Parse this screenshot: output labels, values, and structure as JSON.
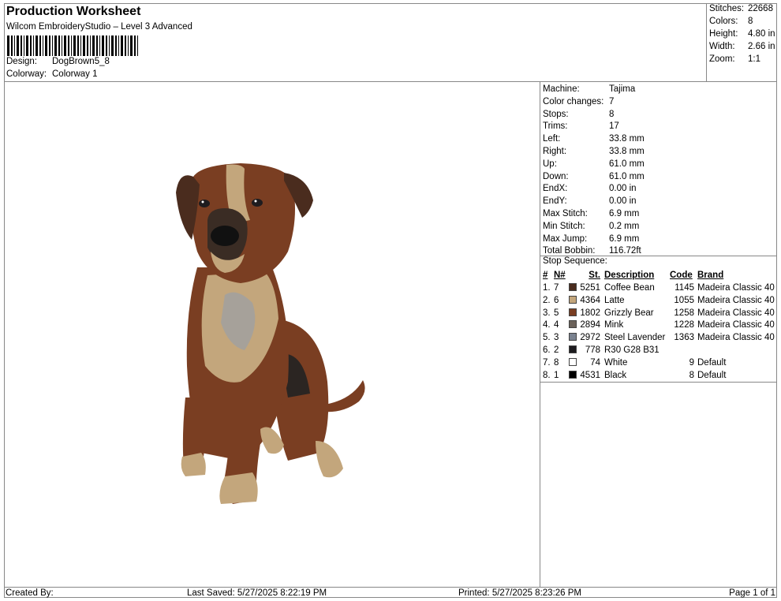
{
  "header": {
    "title": "Production Worksheet",
    "subtitle": "Wilcom EmbroideryStudio – Level 3 Advanced",
    "design_label": "Design:",
    "design_value": "DogBrown5_8",
    "colorway_label": "Colorway:",
    "colorway_value": "Colorway 1"
  },
  "summary": [
    {
      "label": "Stitches:",
      "value": "22668"
    },
    {
      "label": "Colors:",
      "value": "8"
    },
    {
      "label": "Height:",
      "value": "4.80 in"
    },
    {
      "label": "Width:",
      "value": "2.66 in"
    },
    {
      "label": "Zoom:",
      "value": "1:1"
    }
  ],
  "machine_info": [
    {
      "label": "Machine:",
      "value": "Tajima"
    },
    {
      "label": "Color changes:",
      "value": "7"
    },
    {
      "label": "Stops:",
      "value": "8"
    },
    {
      "label": "Trims:",
      "value": "17"
    },
    {
      "label": "Left:",
      "value": "33.8 mm"
    },
    {
      "label": "Right:",
      "value": "33.8 mm"
    },
    {
      "label": "Up:",
      "value": "61.0 mm"
    },
    {
      "label": "Down:",
      "value": "61.0 mm"
    },
    {
      "label": "EndX:",
      "value": "0.00 in"
    },
    {
      "label": "EndY:",
      "value": "0.00 in"
    },
    {
      "label": "Max Stitch:",
      "value": "6.9 mm"
    },
    {
      "label": "Min Stitch:",
      "value": "0.2 mm"
    },
    {
      "label": "Max Jump:",
      "value": "6.9 mm"
    },
    {
      "label": "Total Bobbin:",
      "value": "116.72ft"
    }
  ],
  "stop_sequence": {
    "label": "Stop Sequence:",
    "headers": {
      "idx": "#",
      "num": "N#",
      "st": "St.",
      "desc": "Description",
      "code": "Code",
      "brand": "Brand"
    },
    "rows": [
      {
        "idx": "1.",
        "num": "7",
        "color": "#4a2c1e",
        "st": "5251",
        "desc": "Coffee Bean",
        "code": "1145",
        "brand": "Madeira Classic 40"
      },
      {
        "idx": "2.",
        "num": "6",
        "color": "#c3a67c",
        "st": "4364",
        "desc": "Latte",
        "code": "1055",
        "brand": "Madeira Classic 40"
      },
      {
        "idx": "3.",
        "num": "5",
        "color": "#7a3e22",
        "st": "1802",
        "desc": "Grizzly Bear",
        "code": "1258",
        "brand": "Madeira Classic 40"
      },
      {
        "idx": "4.",
        "num": "4",
        "color": "#6b625a",
        "st": "2894",
        "desc": "Mink",
        "code": "1228",
        "brand": "Madeira Classic 40"
      },
      {
        "idx": "5.",
        "num": "3",
        "color": "#7a8290",
        "st": "2972",
        "desc": "Steel Lavender",
        "code": "1363",
        "brand": "Madeira Classic 40"
      },
      {
        "idx": "6.",
        "num": "2",
        "color": "#1e1c1f",
        "st": "778",
        "desc": "R30 G28 B31",
        "code": "",
        "brand": ""
      },
      {
        "idx": "7.",
        "num": "8",
        "color": "#ffffff",
        "st": "74",
        "desc": "White",
        "code": "9",
        "brand": "Default"
      },
      {
        "idx": "8.",
        "num": "1",
        "color": "#000000",
        "st": "4531",
        "desc": "Black",
        "code": "8",
        "brand": "Default"
      }
    ]
  },
  "footer": {
    "created_by": "Created By:",
    "last_saved": "Last Saved: 5/27/2025 8:22:19 PM",
    "printed": "Printed: 5/27/2025 8:23:26 PM",
    "page": "Page 1 of 1"
  }
}
